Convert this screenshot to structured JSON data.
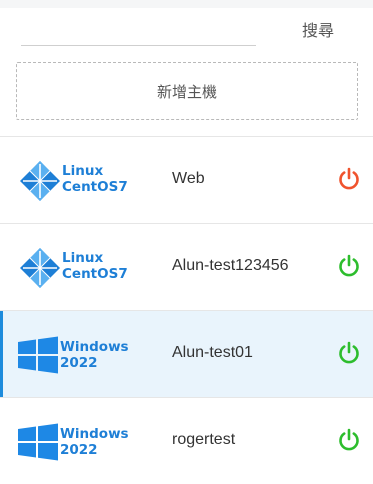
{
  "search": {
    "placeholder": "",
    "value": "",
    "button_label": "搜尋"
  },
  "add_host": {
    "label": "新增主機"
  },
  "colors": {
    "power_off": "#f0532d",
    "power_on": "#2dbd2d",
    "accent": "#1d8bdc",
    "logo_blue": "#1e7fd6",
    "selected_bg": "#e9f4fc"
  },
  "hosts": [
    {
      "os_line1": "Linux",
      "os_line2": "CentOS7",
      "os_icon": "centos-logo-icon",
      "name": "Web",
      "power_state": "off",
      "selected": false
    },
    {
      "os_line1": "Linux",
      "os_line2": "CentOS7",
      "os_icon": "centos-logo-icon",
      "name": "Alun-test123456",
      "power_state": "on",
      "selected": false
    },
    {
      "os_line1": "Windows",
      "os_line2": "2022",
      "os_icon": "windows-logo-icon",
      "name": "Alun-test01",
      "power_state": "on",
      "selected": true
    },
    {
      "os_line1": "Windows",
      "os_line2": "2022",
      "os_icon": "windows-logo-icon",
      "name": "rogertest",
      "power_state": "on",
      "selected": false
    }
  ]
}
